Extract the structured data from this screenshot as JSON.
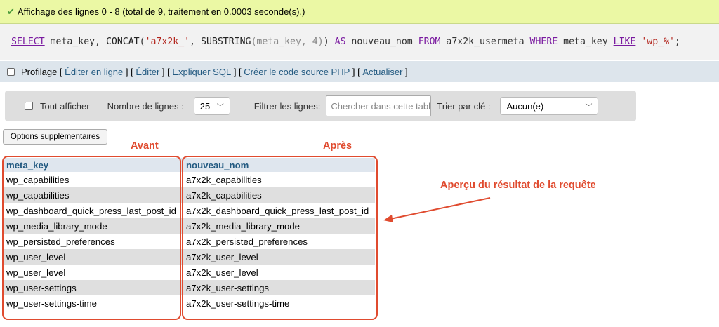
{
  "status": {
    "message": "Affichage des lignes 0 - 8 (total de 9, traitement en 0.0003 seconde(s).)"
  },
  "sql": {
    "select": "SELECT",
    "part1": " meta_key, ",
    "concat": "CONCAT",
    "paren_open": "(",
    "str1": "'a7x2k_'",
    "comma": ", ",
    "substring": "SUBSTRING",
    "args": "(meta_key, 4)",
    "part2": ") ",
    "as": "AS",
    "part3": " nouveau_nom ",
    "from": "FROM",
    "part4": " a7x2k_usermeta ",
    "where": "WHERE",
    "part5": " meta_key ",
    "like": "LIKE",
    "space": " ",
    "str2": "'wp_%'",
    "end": ";"
  },
  "profiling": {
    "label": "Profilage",
    "links": [
      "Éditer en ligne",
      "Éditer",
      "Expliquer SQL",
      "Créer le code source PHP",
      "Actualiser"
    ]
  },
  "toolbar": {
    "show_all": "Tout afficher",
    "rows_label": "Nombre de lignes :",
    "rows_value": "25",
    "filter_label": "Filtrer les lignes:",
    "filter_placeholder": "Chercher dans cette table",
    "sort_label": "Trier par clé :",
    "sort_value": "Aucun(e)"
  },
  "options_button": "Options supplémentaires",
  "annotations": {
    "before": "Avant",
    "after": "Après",
    "preview": "Aperçu du résultat de la requête",
    "color": "#e04b2f"
  },
  "table": {
    "headers": [
      "meta_key",
      "nouveau_nom"
    ],
    "rows": [
      [
        "wp_capabilities",
        "a7x2k_capabilities"
      ],
      [
        "wp_capabilities",
        "a7x2k_capabilities"
      ],
      [
        "wp_dashboard_quick_press_last_post_id",
        "a7x2k_dashboard_quick_press_last_post_id"
      ],
      [
        "wp_media_library_mode",
        "a7x2k_media_library_mode"
      ],
      [
        "wp_persisted_preferences",
        "a7x2k_persisted_preferences"
      ],
      [
        "wp_user_level",
        "a7x2k_user_level"
      ],
      [
        "wp_user_level",
        "a7x2k_user_level"
      ],
      [
        "wp_user-settings",
        "a7x2k_user-settings"
      ],
      [
        "wp_user-settings-time",
        "a7x2k_user-settings-time"
      ]
    ]
  }
}
